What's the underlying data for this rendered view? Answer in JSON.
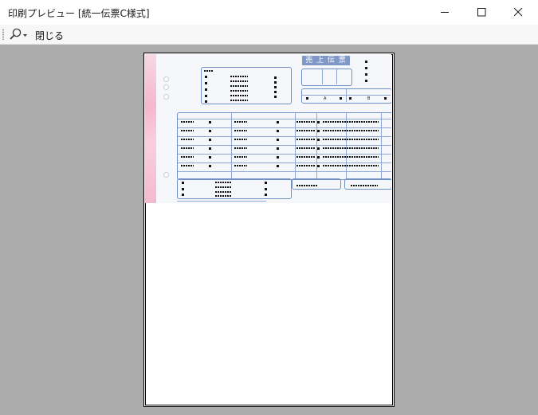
{
  "window": {
    "title": "印刷プレビュー [統一伝票C様式]",
    "minimize_icon": "minimize-icon",
    "maximize_icon": "maximize-icon",
    "close_icon": "close-icon"
  },
  "toolbar": {
    "zoom_icon": "magnifier-icon",
    "close_label": "閉じる"
  },
  "form": {
    "sales_slip_label": "売 上 伝 票",
    "col_a": "A",
    "col_b": "B",
    "colors": {
      "form_blue": "#6f8fc5",
      "label_bg": "#7f98c8",
      "pink_edge": "#f4b7cd",
      "preview_bg": "#ababab"
    }
  }
}
